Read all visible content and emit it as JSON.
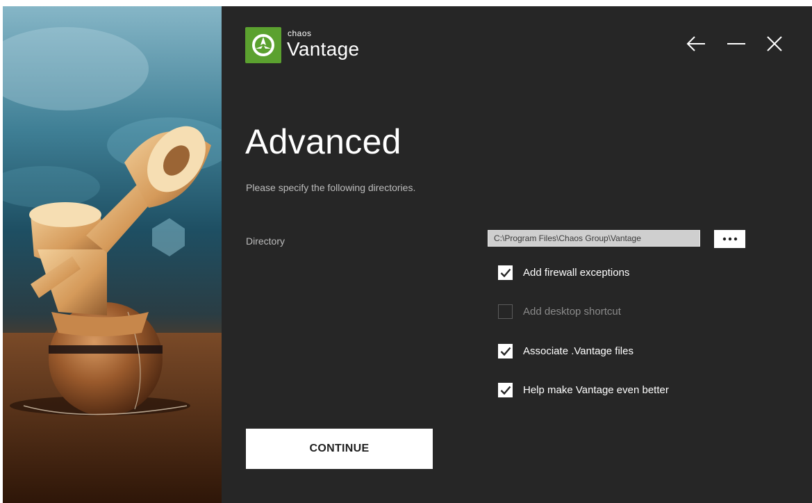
{
  "app": {
    "brand_top": "chaos",
    "brand_name": "Vantage",
    "brand_color": "#5ba12f"
  },
  "window_controls": {
    "back_icon": "arrow-left-icon",
    "minimize_icon": "minimize-icon",
    "close_icon": "close-icon"
  },
  "page": {
    "title": "Advanced",
    "subtitle": "Please specify the following directories."
  },
  "directory": {
    "label": "Directory",
    "value": "C:\\Program Files\\Chaos Group\\Vantage",
    "browse_icon": "ellipsis-icon"
  },
  "options": [
    {
      "label": "Add firewall exceptions",
      "checked": true,
      "enabled": true
    },
    {
      "label": "Add desktop shortcut",
      "checked": false,
      "enabled": false
    },
    {
      "label": "Associate .Vantage files",
      "checked": true,
      "enabled": true
    },
    {
      "label": "Help make Vantage even better",
      "checked": true,
      "enabled": true
    }
  ],
  "actions": {
    "continue_label": "CONTINUE"
  }
}
